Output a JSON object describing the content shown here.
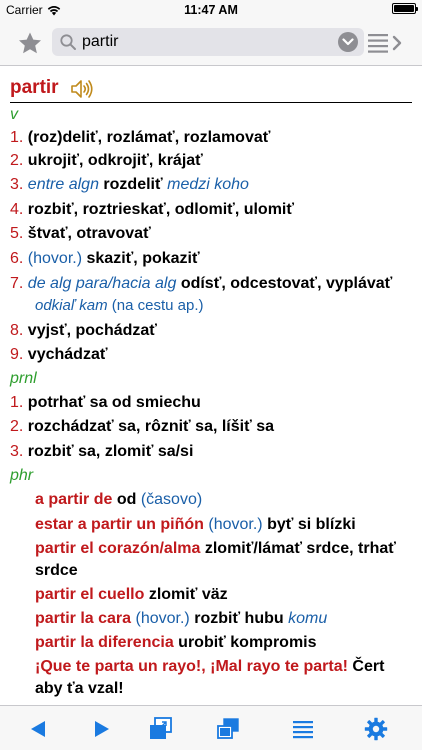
{
  "status_bar": {
    "carrier": "Carrier",
    "time": "11:47 AM"
  },
  "search": {
    "value": "partir"
  },
  "entry": {
    "headword": "partir",
    "pos_v": "v",
    "pos_prnl": "prnl",
    "pos_phr": "phr",
    "v_senses": [
      {
        "num": "1.",
        "text": "(roz)deliť, rozlámať, rozlamovať"
      },
      {
        "num": "2.",
        "text": "ukrojiť, odkrojiť, krájať"
      },
      {
        "num": "3.",
        "gram_pre": "entre algn",
        "text": "rozdeliť",
        "gram_post": "medzi koho"
      },
      {
        "num": "4.",
        "text": "rozbiť, roztrieskať, odlomiť, ulomiť"
      },
      {
        "num": "5.",
        "text": "štvať, otravovať"
      },
      {
        "num": "6.",
        "note": "(hovor.)",
        "text": "skaziť, pokaziť"
      },
      {
        "num": "7.",
        "gram_pre": "de alg para/hacia alg",
        "text": "odísť, odcestovať, vyplávať",
        "gram_line2": "odkiaľ kam",
        "note2": "(na cestu ap.)"
      },
      {
        "num": "8.",
        "text": "vyjsť, pochádzať"
      },
      {
        "num": "9.",
        "text": "vychádzať"
      }
    ],
    "prnl_senses": [
      {
        "num": "1.",
        "text": "potrhať sa od smiechu"
      },
      {
        "num": "2.",
        "text": "rozchádzať sa, rôzniť sa, líšiť sa"
      },
      {
        "num": "3.",
        "text": "rozbiť sa, zlomiť sa/si"
      }
    ],
    "phrases": [
      {
        "phrase": "a partir de",
        "text": "od",
        "note": "(časovo)"
      },
      {
        "phrase": "estar a partir un piñón",
        "note": "(hovor.)",
        "text": "byť si blízki"
      },
      {
        "phrase": "partir el corazón/alma",
        "text": "zlomiť/lámať srdce, trhať",
        "text2": "srdce"
      },
      {
        "phrase": "partir el cuello",
        "text": "zlomiť väz"
      },
      {
        "phrase": "partir la cara",
        "note": "(hovor.)",
        "text": "rozbiť hubu",
        "gram_post": "komu"
      },
      {
        "phrase": "partir la diferencia",
        "text": "urobiť kompromis"
      },
      {
        "phrase": "¡Que te parta un rayo!, ¡Mal rayo te parta!",
        "text": "Čert",
        "text2": "aby ťa vzal!"
      }
    ]
  },
  "colors": {
    "accent": "#1a7ae0",
    "headword": "#c0191c",
    "pos": "#2e9e2e",
    "grammar": "#1a5fa8"
  }
}
